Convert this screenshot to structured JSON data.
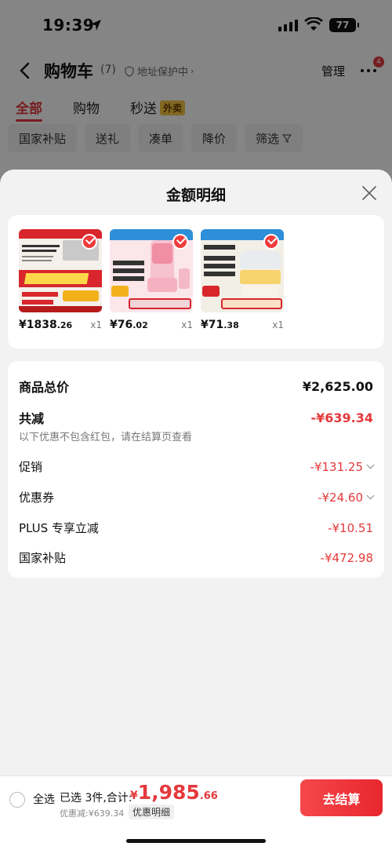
{
  "status_bar": {
    "time": "19:39",
    "battery": "77"
  },
  "header": {
    "title": "购物车",
    "count": "(7)",
    "address_protect": "地址保护中",
    "manage": "管理",
    "more_badge": "4"
  },
  "tabs": [
    {
      "label": "全部"
    },
    {
      "label": "购物"
    },
    {
      "label": "秒送",
      "tag": "外卖"
    }
  ],
  "filters": [
    "国家补贴",
    "送礼",
    "凑单",
    "降价",
    "筛选"
  ],
  "sheet": {
    "title": "金额明细",
    "products": [
      {
        "price_int": "¥1838",
        "price_dec": ".26",
        "qty": "x1"
      },
      {
        "price_int": "¥76",
        "price_dec": ".02",
        "qty": "x1"
      },
      {
        "price_int": "¥71",
        "price_dec": ".38",
        "qty": "x1"
      }
    ],
    "rows": {
      "goods_total": {
        "label": "商品总价",
        "value": "¥2,625.00"
      },
      "total_reduce": {
        "label": "共减",
        "value": "-¥639.34",
        "note": "以下优惠不包含红包，请在结算页查看"
      },
      "promotion": {
        "label": "促销",
        "value": "-¥131.25"
      },
      "coupon": {
        "label": "优惠券",
        "value": "-¥24.60"
      },
      "plus": {
        "label": "PLUS 专享立减",
        "value": "-¥10.51"
      },
      "subsidy": {
        "label": "国家补贴",
        "value": "-¥472.98"
      }
    }
  },
  "bottom_bar": {
    "select_all": "全选",
    "selected_info": "已选 3件,合计:",
    "total_currency": "¥",
    "total_int": "1,985",
    "total_dec": ".66",
    "saved": "优惠减:¥639.34",
    "detail_tag": "优惠明细",
    "checkout": "去结算"
  },
  "colors": {
    "accent": "#e4393c",
    "sheet_bg": "#f2f2f2"
  }
}
